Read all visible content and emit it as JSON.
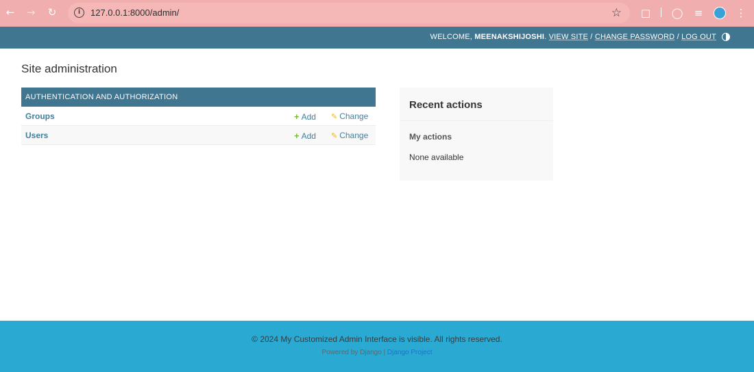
{
  "browser": {
    "url": "127.0.0.1:8000/admin/",
    "icons": [
      "back-arrow-icon",
      "forward-arrow-icon",
      "reload-icon",
      "info-icon",
      "star-icon",
      "extensions-icon",
      "performance-icon",
      "media-icon",
      "profile-icon",
      "kebab-menu-icon"
    ]
  },
  "header": {
    "welcome": "WELCOME, ",
    "username": "MEENAKSHIJOSHI",
    "period": ". ",
    "view_site": "VIEW SITE",
    "sep1": " / ",
    "change_password": "CHANGE PASSWORD",
    "sep2": " / ",
    "log_out": "LOG OUT",
    "bg_color": "#417690"
  },
  "content": {
    "title": "Site administration",
    "app": {
      "caption": "AUTHENTICATION AND AUTHORIZATION",
      "models": [
        {
          "name": "Groups",
          "add": "Add",
          "change": "Change"
        },
        {
          "name": "Users",
          "add": "Add",
          "change": "Change"
        }
      ]
    },
    "recent": {
      "title": "Recent actions",
      "subtitle": "My actions",
      "empty": "None available"
    }
  },
  "footer": {
    "line1": "© 2024 My Customized Admin Interface is visible. All rights reserved.",
    "powered": "Powered by Django | ",
    "django_link": "Django Project",
    "bg_color": "#2aa9d3"
  }
}
